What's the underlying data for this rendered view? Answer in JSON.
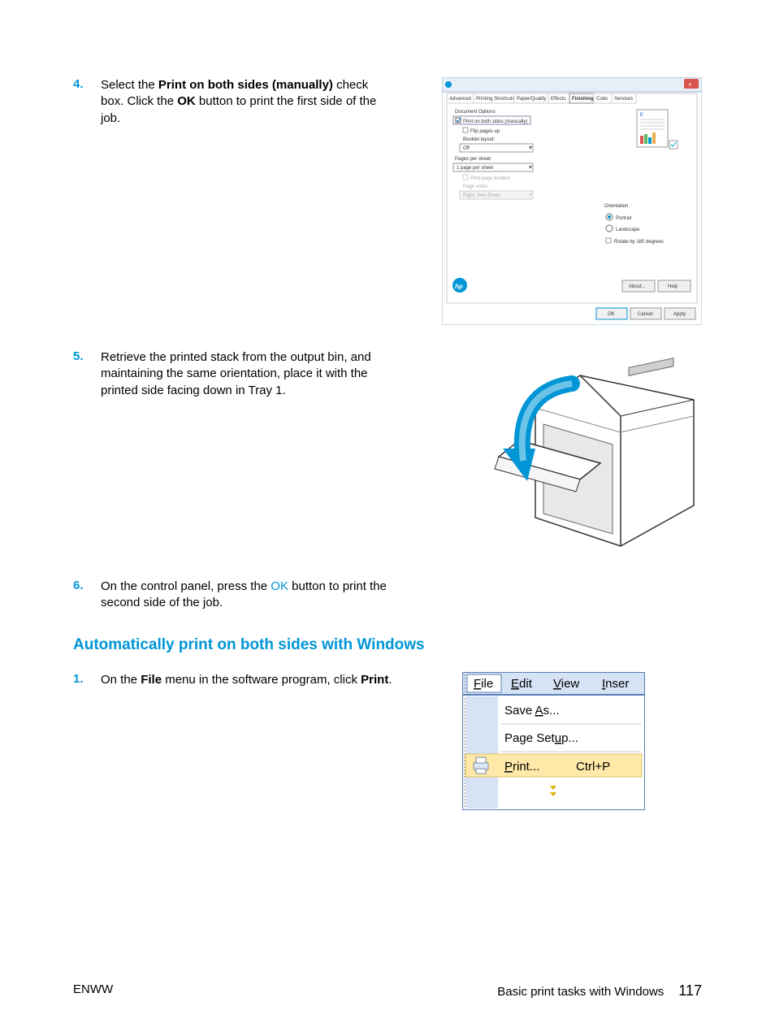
{
  "steps": {
    "s4": {
      "num": "4.",
      "text_pre": "Select the ",
      "bold1": "Print on both sides (manually)",
      "text_mid": " check box. Click the ",
      "bold2": "OK",
      "text_post": " button to print the first side of the job."
    },
    "s5": {
      "num": "5.",
      "text": "Retrieve the printed stack from the output bin, and maintaining the same orientation, place it with the printed side facing down in Tray 1."
    },
    "s6": {
      "num": "6.",
      "text_pre": "On the control panel, press the ",
      "link": "OK",
      "text_post": " button to print the second side of the job."
    },
    "s1": {
      "num": "1.",
      "text_pre": "On the ",
      "bold1": "File",
      "text_mid": " menu in the software program, click ",
      "bold2": "Print",
      "text_post": "."
    }
  },
  "heading": "Automatically print on both sides with Windows",
  "dialog": {
    "tabs": [
      "Advanced",
      "Printing Shortcuts",
      "Paper/Quality",
      "Effects",
      "Finishing",
      "Color",
      "Services"
    ],
    "doc_options": "Document Options",
    "print_both": "Print on both sides (manually)",
    "flip": "Flip pages up",
    "booklet": "Booklet layout:",
    "off": "Off",
    "pps_label": "Pages per sheet:",
    "pps": "1 page per sheet",
    "borders": "Print page borders",
    "page_order": "Page order:",
    "rtd": "Right, then Down",
    "orientation": "Orientation",
    "portrait": "Portrait",
    "landscape": "Landscape",
    "rotate": "Rotate by 180 degrees",
    "about": "About...",
    "help": "Help",
    "ok": "OK",
    "cancel": "Cancel",
    "apply": "Apply"
  },
  "menu": {
    "file": "File",
    "edit": "Edit",
    "view": "View",
    "inser": "Inser",
    "save_as": "Save As...",
    "page_setup": "Page Setup...",
    "print": "Print...",
    "shortcut": "Ctrl+P"
  },
  "footer": {
    "left": "ENWW",
    "right": "Basic print tasks with Windows",
    "page": "117"
  }
}
